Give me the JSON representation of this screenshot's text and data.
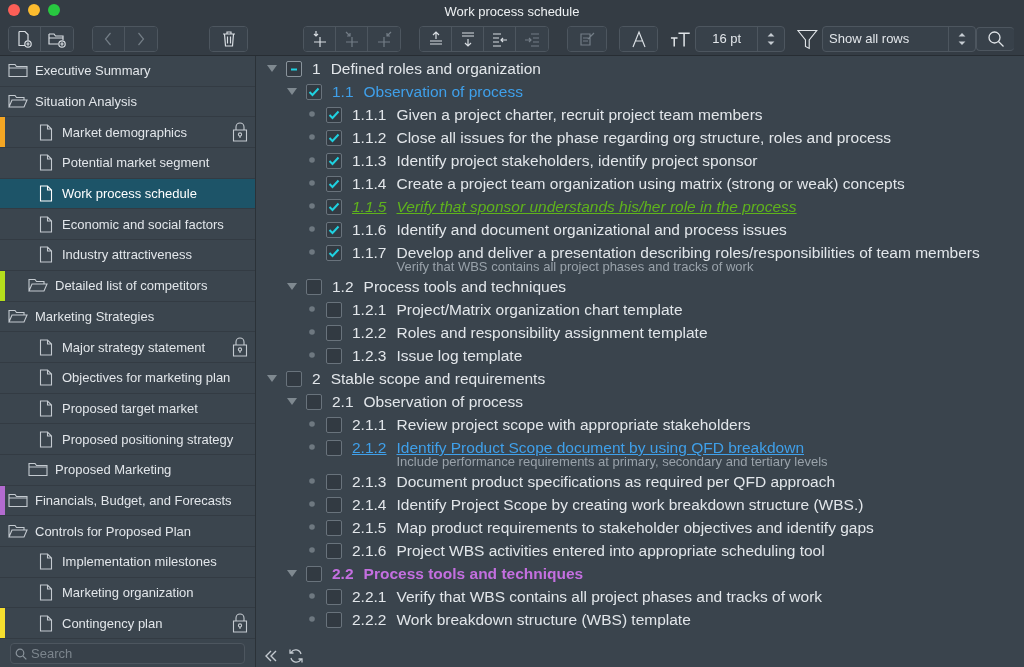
{
  "window": {
    "title": "Work process schedule"
  },
  "toolbar": {
    "groups": [
      [
        {
          "kind": "new-file",
          "disabled": false
        },
        {
          "kind": "new-folder",
          "disabled": false
        }
      ],
      [
        {
          "kind": "back",
          "disabled": true
        },
        {
          "kind": "forward",
          "disabled": true
        }
      ],
      [
        {
          "kind": "trash",
          "disabled": false
        }
      ],
      [
        {
          "kind": "add-above",
          "disabled": false
        },
        {
          "kind": "add-below",
          "disabled": true
        },
        {
          "kind": "add-parent",
          "disabled": true
        }
      ],
      [
        {
          "kind": "move-up",
          "disabled": false
        },
        {
          "kind": "move-down",
          "disabled": false
        },
        {
          "kind": "outdent",
          "disabled": false
        },
        {
          "kind": "indent",
          "disabled": true
        }
      ],
      [
        {
          "kind": "note",
          "disabled": true
        }
      ],
      [
        {
          "kind": "font",
          "disabled": false
        }
      ]
    ],
    "font_size": "16 pt",
    "filter": "Show all rows"
  },
  "sidebar": {
    "items": [
      {
        "kind": "folder",
        "label": "Executive Summary",
        "expanded": false,
        "selected": false,
        "locked": false
      },
      {
        "kind": "folder",
        "label": "Situation Analysis",
        "expanded": true,
        "selected": false,
        "locked": false,
        "children": [
          {
            "kind": "file",
            "label": "Market demographics",
            "selected": false,
            "locked": true,
            "color": "#f5a623"
          },
          {
            "kind": "file",
            "label": "Potential market segment",
            "selected": false,
            "locked": false
          },
          {
            "kind": "file",
            "label": "Work process schedule",
            "selected": true,
            "locked": false
          },
          {
            "kind": "file",
            "label": "Economic and social factors",
            "selected": false,
            "locked": false
          },
          {
            "kind": "file",
            "label": "Industry attractiveness",
            "selected": false,
            "locked": false
          },
          {
            "kind": "folder",
            "label": "Detailed list of competitors",
            "expanded": true,
            "selected": false,
            "locked": false,
            "color": "#b5df1c"
          }
        ]
      },
      {
        "kind": "folder",
        "label": "Marketing Strategies",
        "expanded": true,
        "selected": false,
        "locked": false,
        "children": [
          {
            "kind": "file",
            "label": "Major strategy statement",
            "selected": false,
            "locked": true
          },
          {
            "kind": "file",
            "label": "Objectives for marketing plan",
            "selected": false,
            "locked": false
          },
          {
            "kind": "file",
            "label": "Proposed target market",
            "selected": false,
            "locked": false
          },
          {
            "kind": "file",
            "label": "Proposed positioning strategy",
            "selected": false,
            "locked": false
          },
          {
            "kind": "folder",
            "label": "Proposed Marketing",
            "expanded": false,
            "selected": false,
            "locked": false
          }
        ]
      },
      {
        "kind": "folder",
        "label": "Financials, Budget, and Forecasts",
        "expanded": false,
        "selected": false,
        "locked": false,
        "color": "#b36bd0"
      },
      {
        "kind": "folder",
        "label": "Controls for Proposed Plan",
        "expanded": true,
        "selected": false,
        "locked": false,
        "children": [
          {
            "kind": "file",
            "label": "Implementation milestones",
            "selected": false,
            "locked": false
          },
          {
            "kind": "file",
            "label": "Marketing organization",
            "selected": false,
            "locked": false
          },
          {
            "kind": "file",
            "label": "Contingency plan",
            "selected": false,
            "locked": true,
            "color": "#f7df2e"
          }
        ]
      }
    ],
    "search": {
      "placeholder": "Search"
    }
  },
  "outline": [
    {
      "number": "1",
      "text": "Defined roles and organization",
      "partial": true,
      "kind": "plain",
      "expanded": true,
      "children": [
        {
          "number": "1.1",
          "text": "Observation of process",
          "checked": true,
          "kind": "plain",
          "color": "#3fa0ea",
          "expanded": true,
          "children": [
            {
              "number": "1.1.1",
              "text": "Given a project charter, recruit project team members",
              "checked": true,
              "kind": "plain"
            },
            {
              "number": "1.1.2",
              "text": "Close all issues for the phase regarding org structure, roles and process",
              "checked": true,
              "kind": "plain"
            },
            {
              "number": "1.1.3",
              "text": "Identify project stakeholders, identify project sponsor",
              "checked": true,
              "kind": "plain"
            },
            {
              "number": "1.1.4",
              "text": "Create a project team organization using matrix (strong or weak) concepts",
              "checked": true,
              "kind": "plain"
            },
            {
              "number": "1.1.5",
              "text": "Verify that sponsor understands his/her role in the process",
              "checked": true,
              "kind": "italic-link",
              "color": "#5fb31c"
            },
            {
              "number": "1.1.6",
              "text": "Identify and document organizational and process issues",
              "checked": true,
              "kind": "plain"
            },
            {
              "number": "1.1.7",
              "text": "Develop and deliver a presentation describing roles/responsibilities of team members",
              "checked": true,
              "kind": "plain",
              "note": "Verify that WBS contains all project phases and tracks of work"
            }
          ]
        },
        {
          "number": "1.2",
          "text": "Process tools and techniques",
          "checked": false,
          "kind": "plain",
          "expanded": true,
          "children": [
            {
              "number": "1.2.1",
              "text": "Project/Matrix organization chart template",
              "checked": false,
              "kind": "plain"
            },
            {
              "number": "1.2.2",
              "text": "Roles and responsibility assignment template",
              "checked": false,
              "kind": "plain"
            },
            {
              "number": "1.2.3",
              "text": "Issue log template",
              "checked": false,
              "kind": "plain"
            }
          ]
        }
      ]
    },
    {
      "number": "2",
      "text": "Stable scope and requirements",
      "checked": false,
      "kind": "plain",
      "expanded": true,
      "children": [
        {
          "number": "2.1",
          "text": "Observation of process",
          "checked": false,
          "kind": "plain",
          "expanded": true,
          "children": [
            {
              "number": "2.1.1",
              "text": "Review project scope with appropriate stakeholders",
              "checked": false,
              "kind": "plain"
            },
            {
              "number": "2.1.2",
              "text": "Identify Product Scope document by using QFD breakdown",
              "checked": false,
              "kind": "link",
              "color": "#3fa0ea",
              "note": "Include performance requirements at primary, secondary and tertiary levels"
            },
            {
              "number": "2.1.3",
              "text": "Document product specifications as required per QFD approach",
              "checked": false,
              "kind": "plain"
            },
            {
              "number": "2.1.4",
              "text": "Identify Project Scope by creating work breakdown structure (WBS.)",
              "checked": false,
              "kind": "plain"
            },
            {
              "number": "2.1.5",
              "text": "Map product requirements to stakeholder objectives and identify gaps",
              "checked": false,
              "kind": "plain"
            },
            {
              "number": "2.1.6",
              "text": "Project WBS activities entered into appropriate scheduling tool",
              "checked": false,
              "kind": "plain"
            }
          ]
        },
        {
          "number": "2.2",
          "text": "Process tools and techniques",
          "checked": false,
          "kind": "bold",
          "color": "#c46fe0",
          "expanded": true,
          "children": [
            {
              "number": "2.2.1",
              "text": "Verify that WBS contains all project phases and tracks of work",
              "checked": false,
              "kind": "plain"
            },
            {
              "number": "2.2.2",
              "text": "Work breakdown structure (WBS) template",
              "checked": false,
              "kind": "plain"
            }
          ]
        }
      ]
    }
  ]
}
